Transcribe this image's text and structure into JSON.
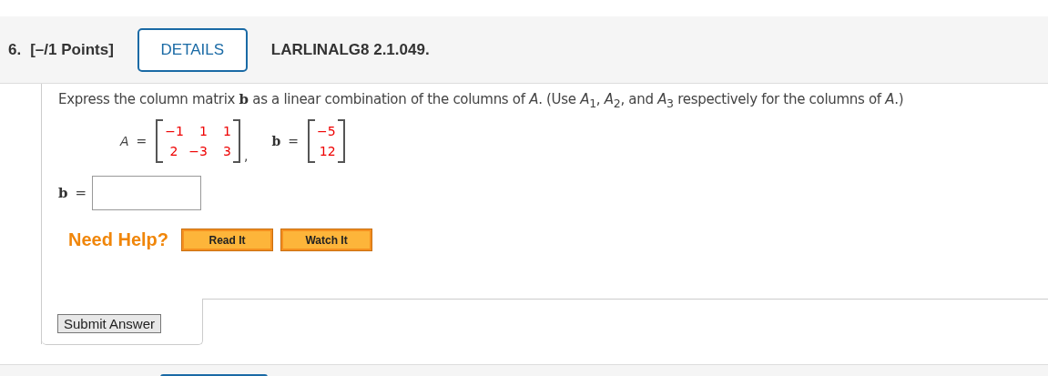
{
  "header": {
    "number": "6.",
    "points": "[–/1 Points]",
    "details_button": "DETAILS",
    "problem_id": "LARLINALG8 2.1.049."
  },
  "question": {
    "text": "Express the column matrix **b** as a linear combination of the columns of *A*. (Use *A*$_{1}$, *A*$_{2}$, and *A*$_{3}$ respectively for the columns of *A*.)",
    "matrices": [
      {
        "label": "A",
        "bold": false,
        "equals": "=",
        "rows": [
          [
            "−1",
            "1",
            "1"
          ],
          [
            "2",
            "−3",
            "3"
          ]
        ],
        "separator": ","
      },
      {
        "label": "b",
        "bold": true,
        "equals": "=",
        "rows": [
          [
            "−5"
          ],
          [
            "12"
          ]
        ]
      }
    ]
  },
  "answer": {
    "label": "b",
    "equals": "="
  },
  "help": {
    "label": "Need Help?",
    "buttons": [
      "Read It",
      "Watch It"
    ]
  },
  "submit_button": "Submit Answer"
}
